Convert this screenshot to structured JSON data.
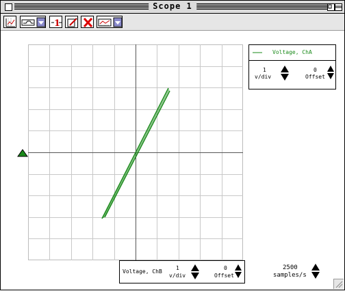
{
  "window": {
    "title": "Scope 1"
  },
  "toolbar": {
    "items": [
      {
        "name": "display-grid-icon"
      },
      {
        "name": "waveform-dropdown-icon"
      },
      {
        "name": "trigger-1-icon"
      },
      {
        "name": "edit-icon"
      },
      {
        "name": "delete-x-icon"
      },
      {
        "name": "data-source-dropdown-icon"
      }
    ]
  },
  "trace": {
    "color": "#1a8a1a"
  },
  "channel_panel": {
    "legend_label": "Voltage, ChA",
    "vdiv_value": "1",
    "vdiv_unit": "v/div",
    "offset_value": "0",
    "offset_label": "Offset"
  },
  "x_panel": {
    "channel_label": "Voltage, ChB",
    "vdiv_value": "1",
    "vdiv_unit": "v/div",
    "offset_value": "0",
    "offset_label": "Offset"
  },
  "sample_panel": {
    "rate_value": "2500",
    "rate_unit": "samples/s"
  }
}
